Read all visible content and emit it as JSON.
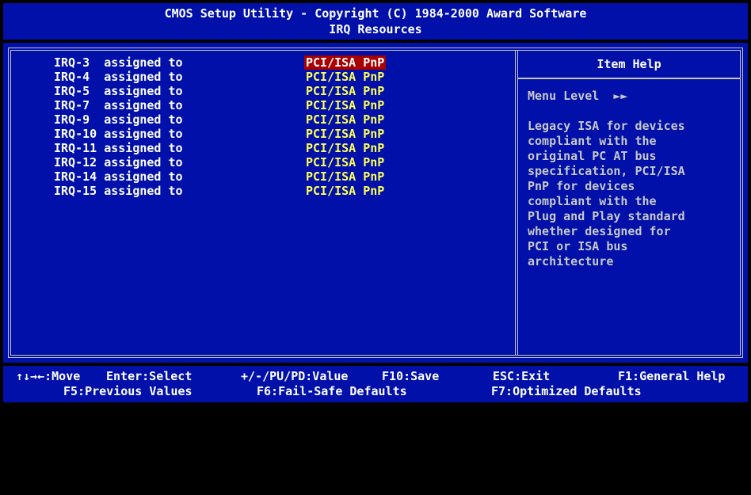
{
  "header": {
    "title": "CMOS Setup Utility - Copyright (C) 1984-2000 Award Software",
    "subtitle": "IRQ Resources"
  },
  "settings": [
    {
      "label": "IRQ-3  assigned to",
      "value": "PCI/ISA PnP",
      "selected": true
    },
    {
      "label": "IRQ-4  assigned to",
      "value": "PCI/ISA PnP"
    },
    {
      "label": "IRQ-5  assigned to",
      "value": "PCI/ISA PnP"
    },
    {
      "label": "IRQ-7  assigned to",
      "value": "PCI/ISA PnP"
    },
    {
      "label": "IRQ-9  assigned to",
      "value": "PCI/ISA PnP"
    },
    {
      "label": "IRQ-10 assigned to",
      "value": "PCI/ISA PnP"
    },
    {
      "label": "IRQ-11 assigned to",
      "value": "PCI/ISA PnP"
    },
    {
      "label": "IRQ-12 assigned to",
      "value": "PCI/ISA PnP"
    },
    {
      "label": "IRQ-14 assigned to",
      "value": "PCI/ISA PnP"
    },
    {
      "label": "IRQ-15 assigned to",
      "value": "PCI/ISA PnP"
    }
  ],
  "help": {
    "title": "Item Help",
    "menu_level_label": "Menu Level",
    "menu_level_arrows": "►►",
    "text_lines": [
      "Legacy ISA for devices",
      "compliant with the",
      "original PC AT bus",
      "specification, PCI/ISA",
      "PnP for devices",
      "compliant with the",
      "Plug and Play standard",
      "whether designed for",
      "PCI or ISA bus",
      "architecture"
    ]
  },
  "footer": {
    "move": "↑↓→←:Move",
    "enter": "Enter:Select",
    "value": "+/-/PU/PD:Value",
    "save": "F10:Save",
    "exit": "ESC:Exit",
    "general_help": "F1:General Help",
    "previous": "F5:Previous Values",
    "fail_safe": "F6:Fail-Safe Defaults",
    "optimized": "F7:Optimized Defaults"
  },
  "colors": {
    "background": "#0010a8",
    "value_text": "#ffff55",
    "selected_bg": "#a80000",
    "help_text": "#c8c8c8"
  }
}
